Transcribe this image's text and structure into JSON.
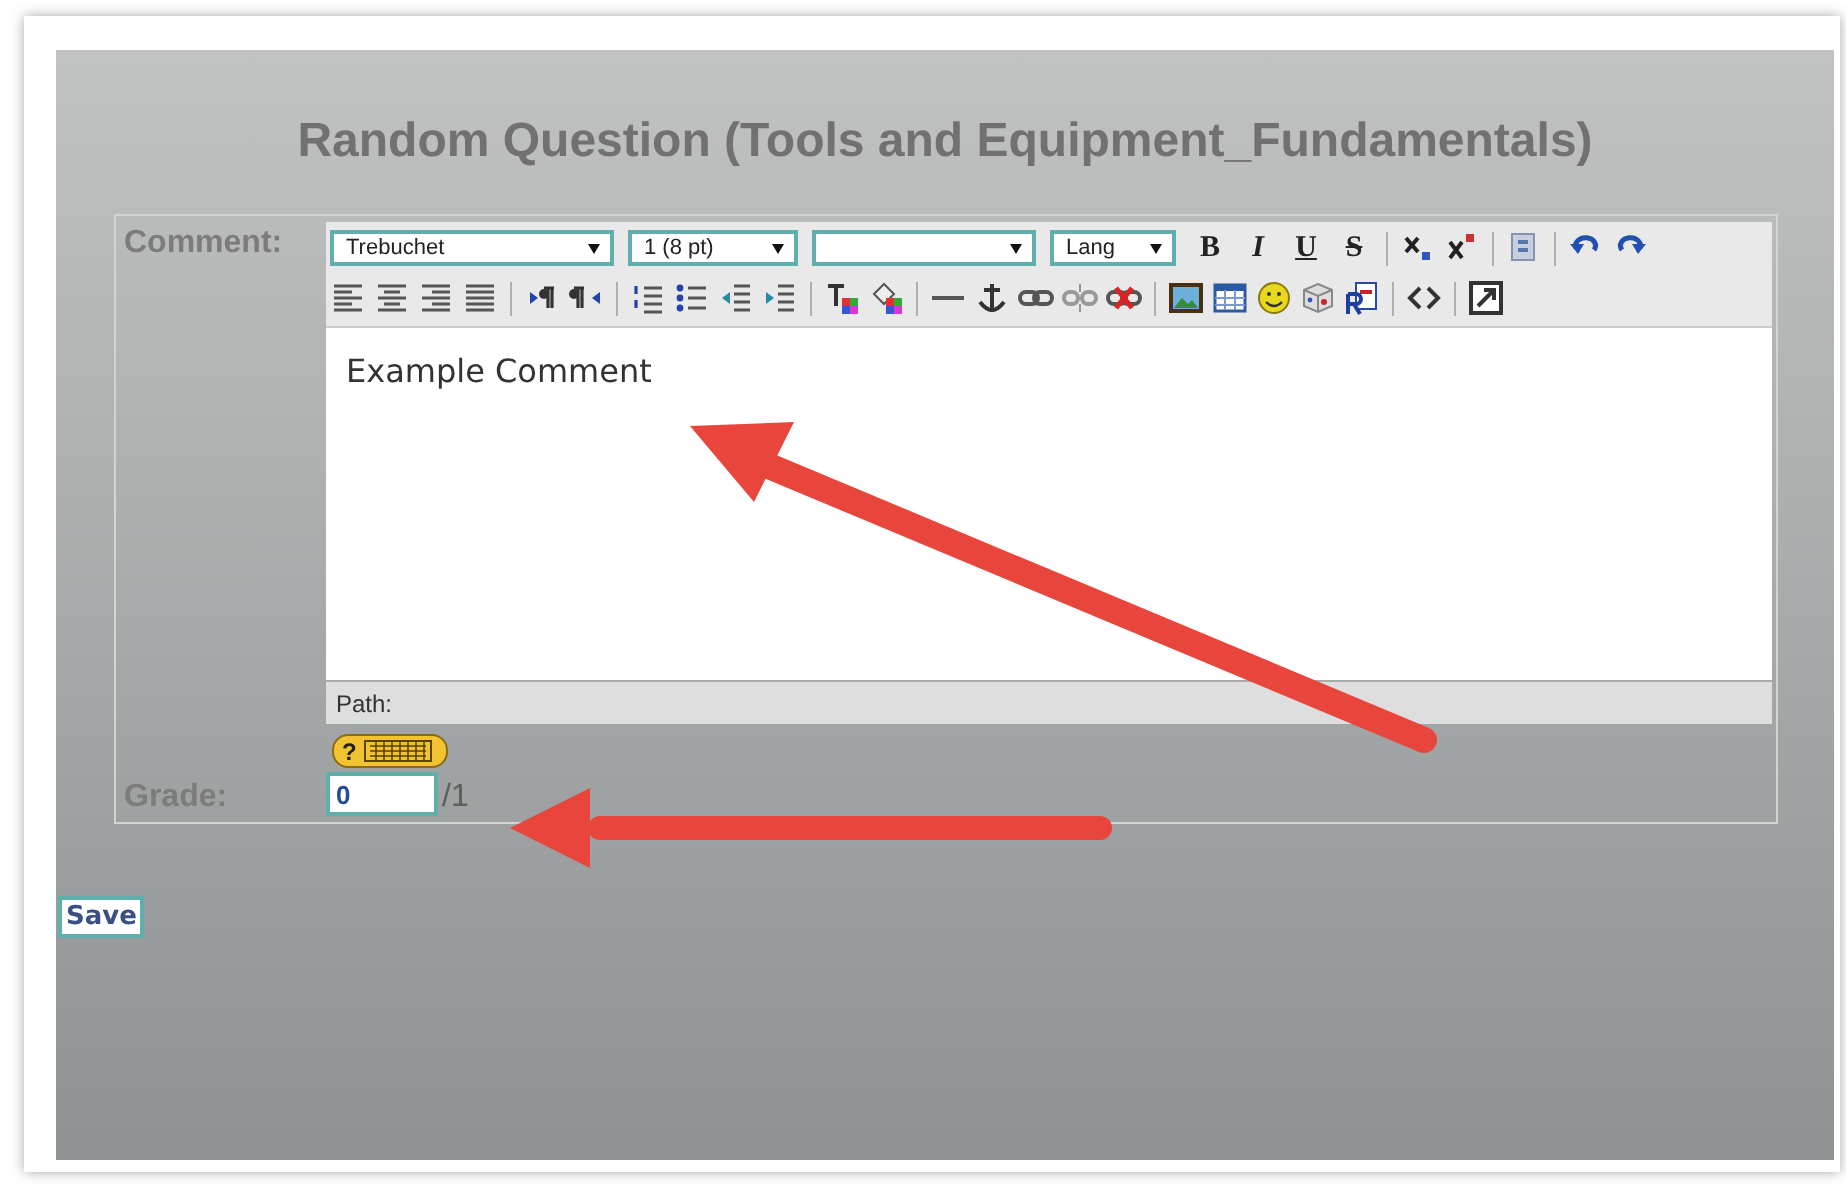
{
  "title": "Random Question (Tools and Equipment_Fundamentals)",
  "comment": {
    "label": "Comment:",
    "toolbar_rows": [
      [
        {
          "kind": "select",
          "value": "Trebuchet"
        },
        {
          "kind": "select",
          "value": "1 (8 pt)"
        },
        {
          "kind": "select"
        },
        {
          "kind": "select",
          "value": "Lang"
        },
        {
          "kind": "bold",
          "label": "B"
        },
        {
          "kind": "italic",
          "label": "I"
        },
        {
          "kind": "underline",
          "label": "U"
        },
        {
          "kind": "strike",
          "label": "S"
        },
        {
          "kind": "separator"
        },
        {
          "kind": "subscript"
        },
        {
          "kind": "superscript"
        },
        {
          "kind": "separator"
        },
        {
          "kind": "paste"
        },
        {
          "kind": "separator"
        },
        {
          "kind": "undo"
        },
        {
          "kind": "redo"
        }
      ],
      [
        {
          "kind": "alignleft"
        },
        {
          "kind": "aligncenter"
        },
        {
          "kind": "alignright"
        },
        {
          "kind": "justify"
        },
        {
          "kind": "separator"
        },
        {
          "kind": "ltr"
        },
        {
          "kind": "rtl"
        },
        {
          "kind": "separator"
        },
        {
          "kind": "ordered"
        },
        {
          "kind": "bullets"
        },
        {
          "kind": "outdent"
        },
        {
          "kind": "indent"
        },
        {
          "kind": "separator"
        },
        {
          "kind": "textcolor"
        },
        {
          "kind": "bgcolor"
        },
        {
          "kind": "separator"
        },
        {
          "kind": "rule"
        },
        {
          "kind": "anchor"
        },
        {
          "kind": "link"
        },
        {
          "kind": "unlink"
        },
        {
          "kind": "removelink"
        },
        {
          "kind": "separator"
        },
        {
          "kind": "image"
        },
        {
          "kind": "table"
        },
        {
          "kind": "smiley"
        },
        {
          "kind": "cube"
        },
        {
          "kind": "document"
        },
        {
          "kind": "separator"
        },
        {
          "kind": "code"
        },
        {
          "kind": "separator"
        },
        {
          "kind": "fullscreen"
        }
      ]
    ],
    "content": "Example Comment",
    "path_label": "Path:",
    "help_badge": {
      "label": "?"
    }
  },
  "grade": {
    "label": "Grade:",
    "value": "0",
    "max": "/1"
  },
  "save_button": "Save"
}
